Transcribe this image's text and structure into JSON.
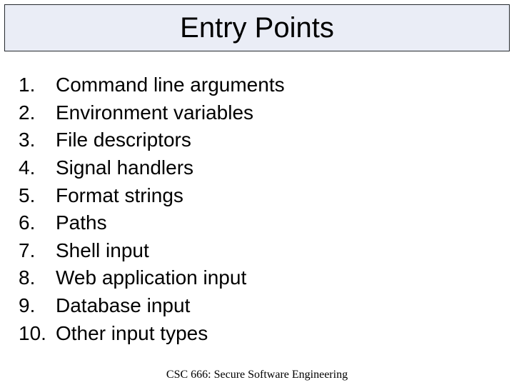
{
  "title": "Entry Points",
  "items": [
    {
      "num": "1.",
      "text": "Command line arguments"
    },
    {
      "num": "2.",
      "text": "Environment variables"
    },
    {
      "num": "3.",
      "text": "File descriptors"
    },
    {
      "num": "4.",
      "text": "Signal handlers"
    },
    {
      "num": "5.",
      "text": "Format strings"
    },
    {
      "num": "6.",
      "text": "Paths"
    },
    {
      "num": "7.",
      "text": "Shell input"
    },
    {
      "num": "8.",
      "text": "Web application input"
    },
    {
      "num": "9.",
      "text": "Database input"
    },
    {
      "num": "10.",
      "text": "Other input types"
    }
  ],
  "footer": "CSC 666: Secure Software Engineering"
}
